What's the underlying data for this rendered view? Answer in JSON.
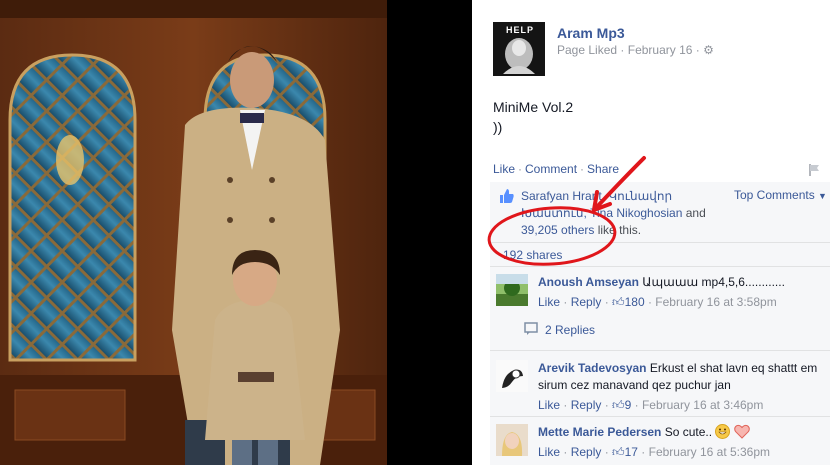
{
  "page": {
    "name": "Aram Mp3",
    "status": "Page Liked",
    "date": "February 16",
    "avatar_text": "HELP"
  },
  "post": {
    "line1": "MiniMe Vol.2",
    "line2": "))"
  },
  "actions": {
    "like": "Like",
    "comment": "Comment",
    "share": "Share"
  },
  "likes": {
    "names": "Sarafyan Hrant, Կունավոր",
    "names2": "Խաստուն, Tina Nikoghosian",
    "and": " and",
    "others": "39,205 others",
    "suffix": " like this.",
    "top_comments": "Top Comments"
  },
  "shares": "192 shares",
  "comments": [
    {
      "name": "Anoush Amseyan",
      "text": "Ապաաա mp4,5,6............",
      "like": "Like",
      "reply": "Reply",
      "count": "180",
      "time": "February 16 at 3:58pm",
      "replies": "2 Replies"
    },
    {
      "name": "Arevik Tadevosyan",
      "text": "Erkust el shat lavn eq shattt em sirum cez manavand qez puchur jan",
      "like": "Like",
      "reply": "Reply",
      "count": "9",
      "time": "February 16 at 3:46pm"
    },
    {
      "name": "Mette Marie Pedersen",
      "text": "So cute..",
      "like": "Like",
      "reply": "Reply",
      "count": "17",
      "time": "February 16 at 5:36pm"
    }
  ],
  "colors": {
    "link": "#3b5998",
    "annotation": "#e0161b",
    "ufi_bg": "#f6f7f9"
  }
}
